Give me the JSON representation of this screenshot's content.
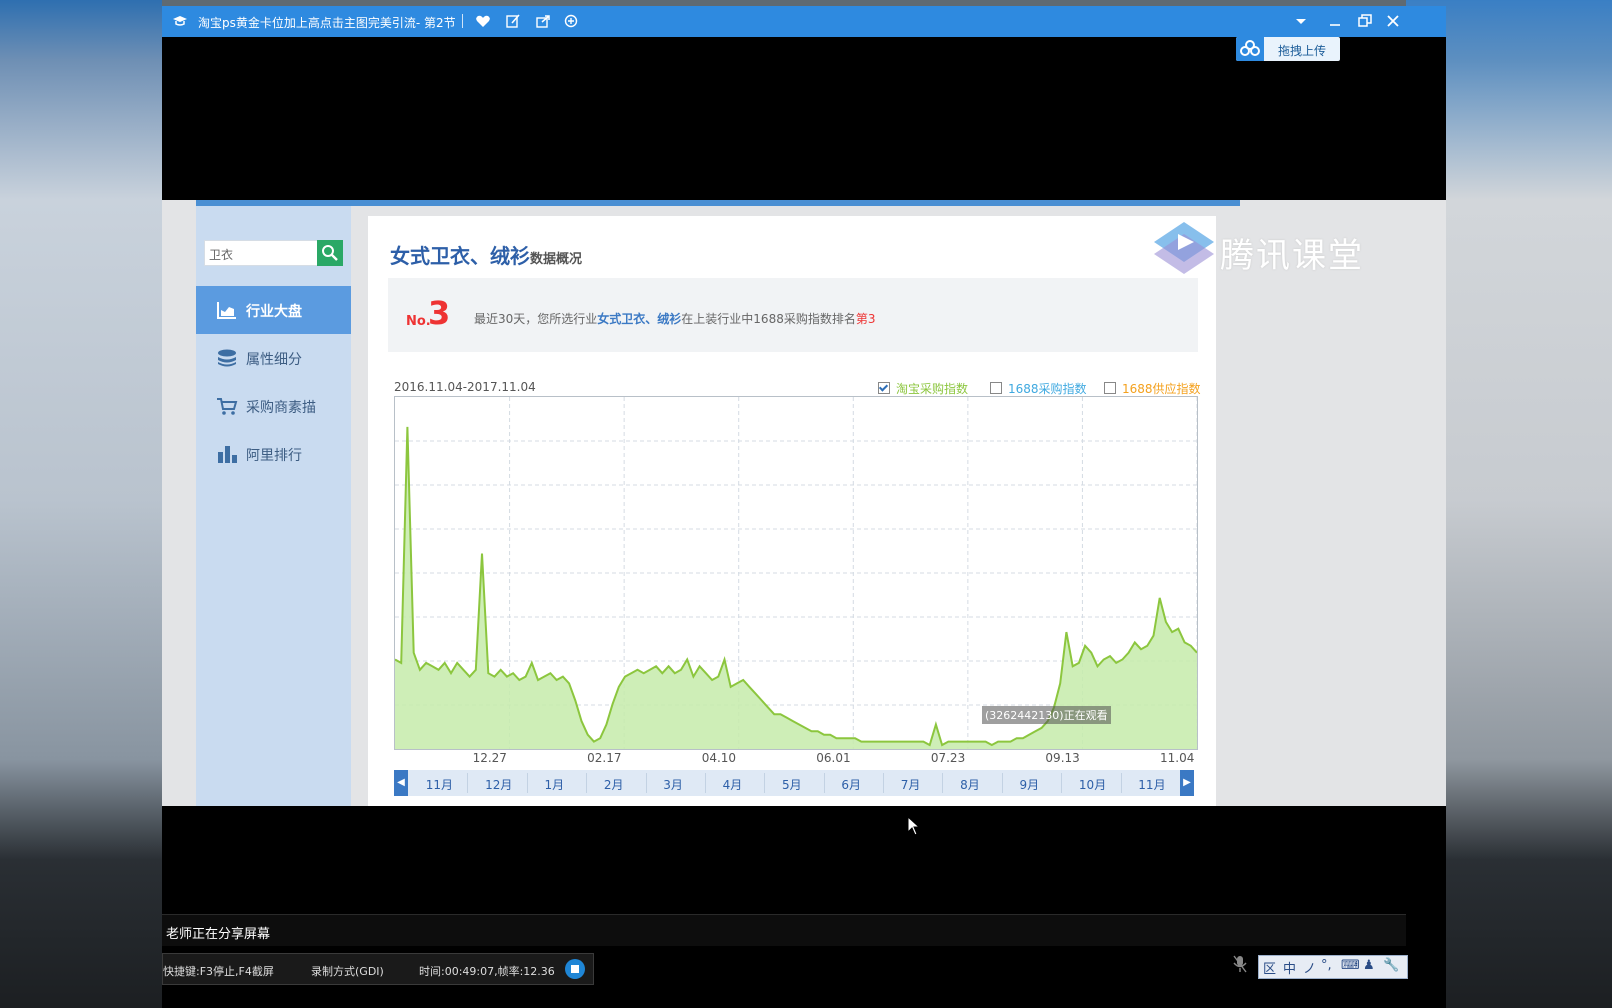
{
  "window": {
    "title": "淘宝ps黄金卡位加上高点击主图完美引流- 第2节",
    "upload_label": "拖拽上传"
  },
  "sidebar": {
    "search_value": "卫衣",
    "items": [
      {
        "label": "行业大盘",
        "icon": "chart-area-icon",
        "active": true
      },
      {
        "label": "属性细分",
        "icon": "layers-icon",
        "active": false
      },
      {
        "label": "采购商素描",
        "icon": "cart-icon",
        "active": false
      },
      {
        "label": "阿里排行",
        "icon": "bar-chart-icon",
        "active": false
      }
    ]
  },
  "main": {
    "title": "女式卫衣、绒衫",
    "title_suffix": "数据概况",
    "rank_prefix": "No.",
    "rank_number": "3",
    "rank_text_1": "最近30天，您所选行业",
    "rank_text_hl": "女式卫衣、绒衫",
    "rank_text_2": "在上装行业中1688采购指数排名",
    "rank_text_red": "第3",
    "date_range": "2016.11.04-2017.11.04",
    "legend": [
      {
        "label": "淘宝采购指数",
        "color": "#8cc63e",
        "checked": true
      },
      {
        "label": "1688采购指数",
        "color": "#3fa9e0",
        "checked": false
      },
      {
        "label": "1688供应指数",
        "color": "#f4a11e",
        "checked": false
      }
    ],
    "months": [
      "11月",
      "12月",
      "1月",
      "2月",
      "3月",
      "4月",
      "5月",
      "6月",
      "7月",
      "8月",
      "9月",
      "10月",
      "11月"
    ],
    "viewer_note": "(3262442130)正在观看",
    "watermark": "腾讯课堂"
  },
  "chart_data": {
    "type": "area",
    "series": [
      {
        "name": "淘宝采购指数",
        "color": "#8cc63e"
      }
    ],
    "x_ticks": [
      "12.27",
      "02.17",
      "04.10",
      "06.01",
      "07.23",
      "09.13",
      "11.04"
    ],
    "y": [
      25,
      24,
      93,
      27,
      22,
      24,
      23,
      22,
      24,
      21,
      24,
      22,
      20,
      22,
      56,
      21,
      20,
      22,
      20,
      21,
      19,
      20,
      24,
      19,
      20,
      21,
      19,
      20,
      18,
      13,
      7,
      3,
      1,
      2,
      6,
      12,
      17,
      20,
      21,
      22,
      21,
      22,
      23,
      21,
      23,
      21,
      22,
      25,
      20,
      23,
      21,
      19,
      20,
      25,
      17,
      18,
      19,
      17,
      15,
      13,
      11,
      9,
      9,
      8,
      7,
      6,
      5,
      4,
      4,
      3,
      3,
      2,
      2,
      2,
      2,
      1,
      1,
      1,
      1,
      1,
      1,
      1,
      1,
      1,
      1,
      1,
      0,
      6,
      0,
      1,
      1,
      1,
      1,
      1,
      1,
      1,
      0,
      1,
      1,
      1,
      2,
      2,
      3,
      4,
      5,
      7,
      11,
      18,
      33,
      23,
      24,
      29,
      27,
      23,
      25,
      26,
      24,
      25,
      27,
      30,
      28,
      29,
      32,
      43,
      36,
      33,
      34,
      30,
      29,
      27
    ],
    "ylim": [
      0,
      100
    ],
    "grid": true
  },
  "bottom": {
    "share_text": "老师正在分享屏幕",
    "status": {
      "shortcut": "快捷键:F3停止,F4截屏",
      "mode": "录制方式(GDI)",
      "time": "时间:00:49:07,帧率:12.36"
    },
    "ime": [
      "区",
      "中",
      "ノ",
      "°,",
      "⌨",
      "♟",
      "🔧"
    ]
  }
}
